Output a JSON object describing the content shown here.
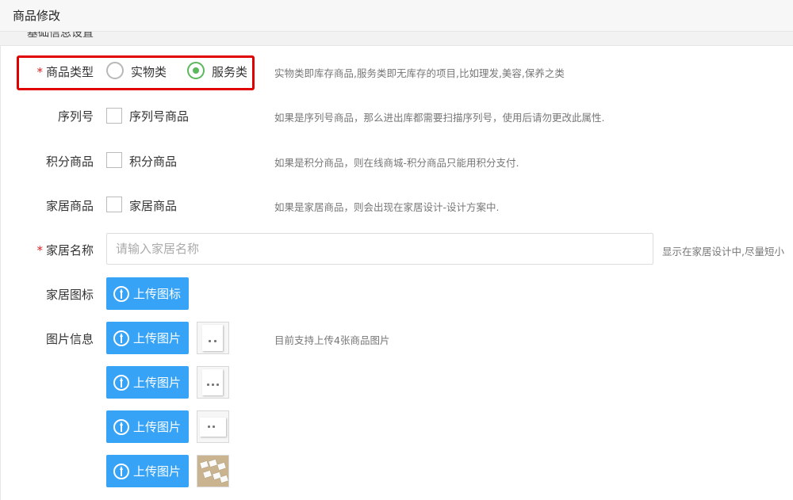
{
  "window": {
    "title": "商品修改"
  },
  "section": {
    "title_cut": "基础信息设置"
  },
  "form": {
    "product_type": {
      "label": "商品类型",
      "required_mark": "*",
      "options": [
        "实物类",
        "服务类"
      ],
      "selected": "服务类",
      "hint": "实物类即库存商品,服务类即无库存的项目,比如理发,美容,保养之类"
    },
    "serial": {
      "label": "序列号",
      "checkbox_label": "序列号商品",
      "checked": false,
      "hint": "如果是序列号商品，那么进出库都需要扫描序列号，使用后请勿更改此属性."
    },
    "points": {
      "label": "积分商品",
      "checkbox_label": "积分商品",
      "checked": false,
      "hint": "如果是积分商品，则在线商城-积分商品只能用积分支付."
    },
    "home": {
      "label": "家居商品",
      "checkbox_label": "家居商品",
      "checked": false,
      "hint": "如果是家居商品，则会出现在家居设计-设计方案中."
    },
    "home_name": {
      "label": "家居名称",
      "required_mark": "*",
      "value": "",
      "placeholder": "请输入家居名称",
      "hint": "显示在家居设计中,尽量短小"
    },
    "home_icon": {
      "label": "家居图标",
      "upload_label": "上传图标"
    },
    "images": {
      "label": "图片信息",
      "upload_label": "上传图片",
      "hint": "目前支持上传4张商品图片",
      "count": 4
    }
  },
  "colors": {
    "required": "#e02020",
    "highlight_border": "#e00000",
    "radio_selected": "#5cb85c",
    "button_bg": "#36a3f7"
  }
}
